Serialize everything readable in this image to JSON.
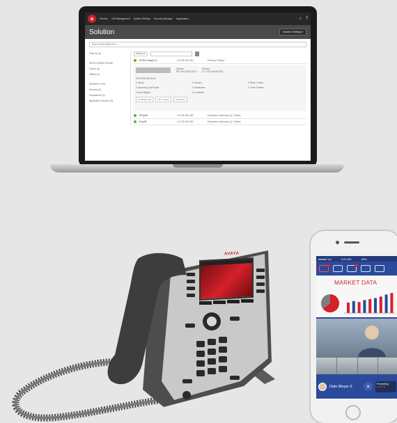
{
  "laptop": {
    "nav": [
      "Devices",
      "Call Management",
      "System Settings",
      "Security Manager",
      "Applications"
    ],
    "top_icons": [
      "bell-icon",
      "help-icon"
    ],
    "page_title": "Solution",
    "action_button": "Solution Settings ▾",
    "search_placeholder": "SOLUTION REMOTE ▾",
    "filters": [
      "Filter All (3)"
    ],
    "left_groups": [
      {
        "header": "DEPLOYMENT MODE",
        "items": [
          "Online (3)",
          "Offline (0)"
        ]
      },
      {
        "header": "SERVER TYPE",
        "items": [
          "Devices (3)",
          "Expansions (3)",
          "Application Servers (3)"
        ]
      }
    ],
    "filter_select": "Actions ▾",
    "rows": [
      {
        "name": "IPOE1-Host(S-1)",
        "ip": "10.125.150.160",
        "desc": "Primary / Select"
      },
      {
        "name": "IPOpeR",
        "ip": "10.125.150.160",
        "desc": "Expansion Gateway (1) / Select"
      },
      {
        "name": "ExpoR",
        "ip": "10.125.150.160",
        "desc": "Expansion Gateway (1) / Select"
      }
    ],
    "detail": {
      "sub1_label": "System",
      "sub1_value": "IPO-AA-0010-0013",
      "sub2_label": "Version",
      "sub2_value": "11.1.200.0 build 320",
      "section": "SYSTEM DETAILS",
      "grid": [
        "0 Users",
        "0 Groups",
        "0 Short Codes",
        "0 Incoming Call Route",
        "0 Directories",
        "0 Time Profiles",
        "0 User Rights",
        "0 Locations",
        ""
      ],
      "chips": [
        "Certificate S/S",
        "Lan 1 Status",
        "Certificate"
      ]
    }
  },
  "desk_phone": {
    "brand": "AVAYA"
  },
  "mobile": {
    "status_time": "3:20 AM",
    "status_left": "●●●●● Voi",
    "status_right": "48%",
    "market_title": "MARKET DATA",
    "caller_name": "Dale Meyer 6",
    "callout_title": "Presenting",
    "callout_rec": "● 01:25",
    "bar_values": [
      0.42,
      0.48,
      0.44,
      0.52,
      0.56,
      0.6,
      0.66,
      0.74,
      0.8
    ],
    "pie_values": [
      0.65,
      0.35
    ],
    "colors": {
      "accent": "#d4212a",
      "blue": "#2b4a9b"
    }
  }
}
